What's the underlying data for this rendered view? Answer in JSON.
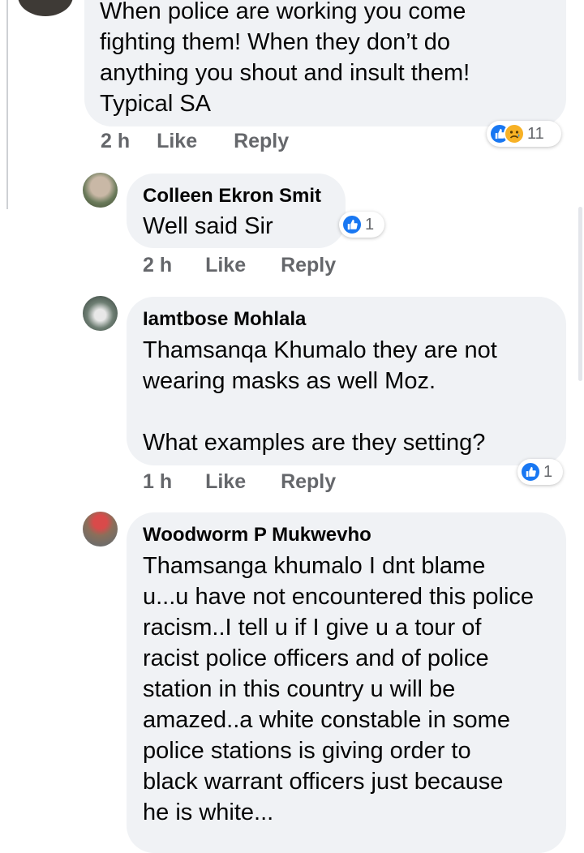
{
  "comments": [
    {
      "author": "",
      "text": "When police are working you come\nfighting them! When they don’t do\nanything you shout and insult them!\nTypical SA",
      "time": "2 h",
      "like_label": "Like",
      "reply_label": "Reply",
      "reactions": [
        "like-icon",
        "sad-icon"
      ],
      "reaction_count": "11"
    },
    {
      "author": "Colleen Ekron Smit",
      "text": "Well said Sir",
      "time": "2 h",
      "like_label": "Like",
      "reply_label": "Reply",
      "reactions": [
        "like-icon"
      ],
      "reaction_count": "1"
    },
    {
      "author": "Iamtbose Mohlala",
      "text": "Thamsanqa Khumalo they are not\nwearing masks as well Moz.\n\nWhat examples are they setting?",
      "time": "1 h",
      "like_label": "Like",
      "reply_label": "Reply",
      "reactions": [
        "like-icon"
      ],
      "reaction_count": "1"
    },
    {
      "author": "Woodworm P Mukwevho",
      "text": "Thamsanga khumalo I dnt blame\nu...u have not encountered this police\nracism..I tell u if I give u a tour of\nracist police officers and of police\nstation in this country u will be\namazed..a white constable in some\npolice stations is giving order to\nblack warrant officers just because\nhe is white...",
      "time": "",
      "like_label": "",
      "reply_label": "",
      "reactions": [],
      "reaction_count": ""
    }
  ],
  "colors": {
    "bubble": "#f0f2f5",
    "meta_text": "#65676b",
    "like_blue": "#1877f2",
    "sad_yellow": "#f7b125"
  }
}
